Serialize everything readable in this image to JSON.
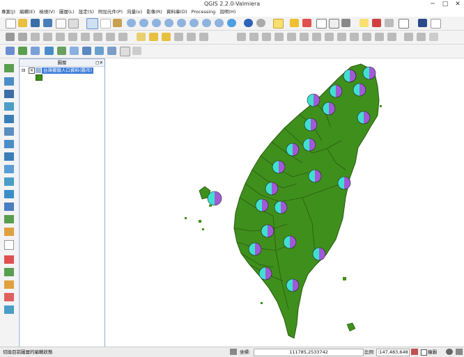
{
  "window": {
    "title": "QGIS 2.2.0-Valmiera",
    "minimize": "─",
    "maximize": "□",
    "close": "✕"
  },
  "menu": [
    "專案(J)",
    "編輯(E)",
    "檢視(V)",
    "圖層(L)",
    "設定(S)",
    "附加元件(P)",
    "向量(o)",
    "影像(R)",
    "資料庫(D)",
    "Processing",
    "說明(H)"
  ],
  "legend": {
    "title": "圖層",
    "layer_name": "台灣鄉鎮人口資料(縣市)",
    "expand_symbol": "⊟",
    "checkbox_symbol": "✕",
    "panel_buttons": "◻✕"
  },
  "status": {
    "message": "切換目前圖層的編輯狀態",
    "coord_label": "坐標:",
    "coord_value": "111785,2533742",
    "scale_label": "比例",
    "scale_value": ":147,483,648",
    "render_label": "繪圖"
  },
  "colors": {
    "land": "#3f8f1c",
    "land_border": "#2a5a12",
    "pie_cyan": "#40e0d0",
    "pie_purple": "#a05ad8",
    "selection": "#3b7bd8"
  },
  "icons": [
    "new-project-icon",
    "open-project-icon",
    "save-project-icon",
    "save-as-icon",
    "new-print-composer-icon",
    "composer-manager-icon",
    "touch-icon",
    "pan-icon",
    "pan-to-selection-icon",
    "zoom-in-icon",
    "zoom-out-icon",
    "zoom-native-icon",
    "zoom-full-icon",
    "zoom-layer-icon",
    "zoom-selection-icon",
    "zoom-last-icon",
    "zoom-next-icon",
    "refresh-icon",
    "identify-icon",
    "select-icon",
    "deselect-icon",
    "open-table-icon",
    "measure-icon",
    "map-tips-icon",
    "annotation-icon",
    "bookmark-icon",
    "text-annotation-icon",
    "help-icon",
    "what-is-this-icon"
  ]
}
